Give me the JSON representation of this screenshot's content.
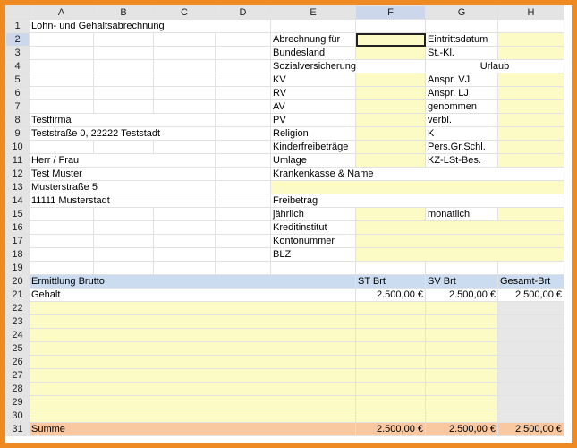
{
  "columns": [
    "A",
    "B",
    "C",
    "D",
    "E",
    "F",
    "G",
    "H"
  ],
  "rows": [
    "1",
    "2",
    "3",
    "4",
    "5",
    "6",
    "7",
    "8",
    "9",
    "10",
    "11",
    "12",
    "13",
    "14",
    "15",
    "16",
    "17",
    "18",
    "19",
    "20",
    "21",
    "22",
    "23",
    "24",
    "25",
    "26",
    "27",
    "28",
    "29",
    "30",
    "31"
  ],
  "title": "Lohn- und Gehaltsabrechnung",
  "company": {
    "name": "Testfirma",
    "address": "Teststraße 0, 22222 Teststadt"
  },
  "employee": {
    "salutation": "Herr / Frau",
    "name": "Test Muster",
    "street": "Musterstraße 5",
    "city": "11111 Musterstadt"
  },
  "labels": {
    "abrechnung_fuer": "Abrechnung für",
    "bundesland": "Bundesland",
    "sozialversicherung": "Sozialversicherung",
    "kv": "KV",
    "rv": "RV",
    "av": "AV",
    "pv": "PV",
    "religion": "Religion",
    "kinderfreibetraege": "Kinderfreibeträge",
    "umlage": "Umlage",
    "krankenkasse": "Krankenkasse & Name",
    "freibetrag": "Freibetrag",
    "jaehrlich": "jährlich",
    "monatlich": "monatlich",
    "kreditinstitut": "Kreditinstitut",
    "kontonummer": "Kontonummer",
    "blz": "BLZ",
    "eintrittsdatum": "Eintrittsdatum",
    "st_kl": "St.-Kl.",
    "urlaub": "Urlaub",
    "anspr_vj": "Anspr. VJ",
    "anspr_lj": "Anspr. LJ",
    "genommen": "genommen",
    "verbl": "verbl.",
    "k": "K",
    "pers_gr_schl": "Pers.Gr.Schl.",
    "kz_lst_bes": "KZ-LSt-Bes."
  },
  "brutto": {
    "header": "Ermittlung Brutto",
    "col_st": "ST Brt",
    "col_sv": "SV Brt",
    "col_gesamt": "Gesamt-Brt",
    "item": "Gehalt",
    "st_value": "2.500,00 €",
    "sv_value": "2.500,00 €",
    "gesamt_value": "2.500,00 €",
    "sum_label": "Summe",
    "sum_st": "2.500,00 €",
    "sum_sv": "2.500,00 €",
    "sum_gesamt": "2.500,00 €"
  },
  "colors": {
    "input_yellow": "#fdfbc5",
    "header_blue": "#cbdcf0",
    "frame_orange": "#ef8a22",
    "sum_peach": "#f9c8a0"
  }
}
